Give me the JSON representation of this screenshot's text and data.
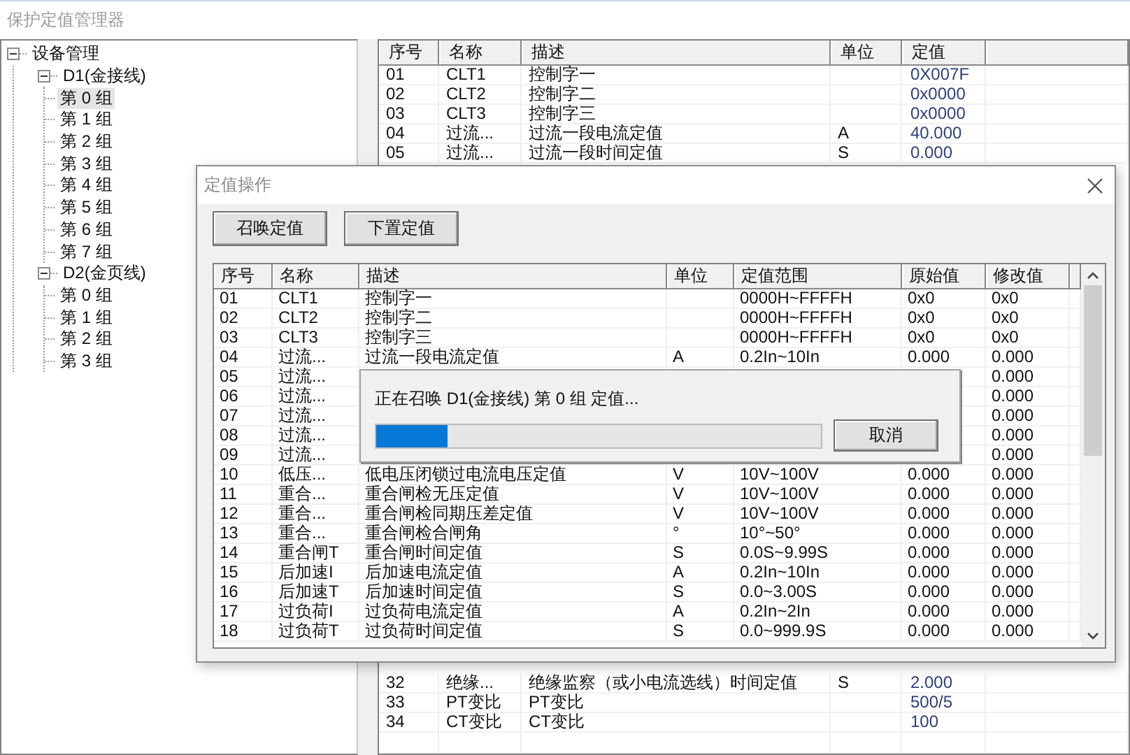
{
  "window": {
    "title": "保护定值管理器"
  },
  "tree": {
    "label": "设备管理",
    "expanded": true,
    "children": [
      {
        "label": "D1(金接线)",
        "expanded": true,
        "children": [
          {
            "label": "第 0 组",
            "selected": true
          },
          {
            "label": "第 1 组",
            "selected": false
          },
          {
            "label": "第 2 组",
            "selected": false
          },
          {
            "label": "第 3 组",
            "selected": false
          },
          {
            "label": "第 4 组",
            "selected": false
          },
          {
            "label": "第 5 组",
            "selected": false
          },
          {
            "label": "第 6 组",
            "selected": false
          },
          {
            "label": "第 7 组",
            "selected": false
          }
        ]
      },
      {
        "label": "D2(金页线)",
        "expanded": true,
        "children": [
          {
            "label": "第 0 组",
            "selected": false
          },
          {
            "label": "第 1 组",
            "selected": false
          },
          {
            "label": "第 2 组",
            "selected": false
          },
          {
            "label": "第 3 组",
            "selected": false
          }
        ]
      }
    ]
  },
  "table": {
    "columns": [
      "序号",
      "名称",
      "描述",
      "单位",
      "定值"
    ],
    "upper_rows": [
      {
        "no": "01",
        "name": "CLT1",
        "desc": "控制字一",
        "value": "0X007F"
      },
      {
        "no": "02",
        "name": "CLT2",
        "desc": "控制字二",
        "value": "0x0000"
      },
      {
        "no": "03",
        "name": "CLT3",
        "desc": "控制字三",
        "value": "0x0000"
      },
      {
        "no": "04",
        "name": "过流...",
        "desc": "过流一段电流定值",
        "unit": "A",
        "value": "40.000"
      },
      {
        "no": "05",
        "name": "过流...",
        "desc": "过流一段时间定值",
        "unit": "S",
        "value": "0.000"
      }
    ],
    "lower_rows": [
      {
        "no": "32",
        "name": "绝缘...",
        "desc": "绝缘监察（或小电流选线）时间定值",
        "unit": "S",
        "value": "2.000"
      },
      {
        "no": "33",
        "name": "PT变比",
        "desc": "PT变比",
        "value": "500/5"
      },
      {
        "no": "34",
        "name": "CT变比",
        "desc": "CT变比",
        "value": "100"
      }
    ]
  },
  "dialog": {
    "title": "定值操作",
    "buttons": [
      "召唤定值",
      "下置定值"
    ],
    "columns": [
      "序号",
      "名称",
      "描述",
      "单位",
      "定值范围",
      "原始值",
      "修改值"
    ],
    "rows": [
      {
        "no": "01",
        "name": "CLT1",
        "desc": "控制字一",
        "range": "0000H~FFFFH",
        "original": "0x0",
        "modified": "0x0"
      },
      {
        "no": "02",
        "name": "CLT2",
        "desc": "控制字二",
        "range": "0000H~FFFFH",
        "original": "0x0",
        "modified": "0x0"
      },
      {
        "no": "03",
        "name": "CLT3",
        "desc": "控制字三",
        "range": "0000H~FFFFH",
        "original": "0x0",
        "modified": "0x0"
      },
      {
        "no": "04",
        "name": "过流...",
        "desc": "过流一段电流定值",
        "unit": "A",
        "range": "0.2In~10In",
        "original": "0.000",
        "modified": "0.000"
      },
      {
        "no": "05",
        "name": "过流...",
        "modified": "0.000"
      },
      {
        "no": "06",
        "name": "过流...",
        "modified": "0.000"
      },
      {
        "no": "07",
        "name": "过流...",
        "modified": "0.000"
      },
      {
        "no": "08",
        "name": "过流...",
        "modified": "0.000"
      },
      {
        "no": "09",
        "name": "过流...",
        "modified": "0.000"
      },
      {
        "no": "10",
        "name": "低压...",
        "desc": "低电压闭锁过电流电压定值",
        "unit": "V",
        "range": "10V~100V",
        "original": "0.000",
        "modified": "0.000"
      },
      {
        "no": "11",
        "name": "重合...",
        "desc": "重合闸检无压定值",
        "unit": "V",
        "range": "10V~100V",
        "original": "0.000",
        "modified": "0.000"
      },
      {
        "no": "12",
        "name": "重合...",
        "desc": "重合闸检同期压差定值",
        "unit": "V",
        "range": "10V~100V",
        "original": "0.000",
        "modified": "0.000"
      },
      {
        "no": "13",
        "name": "重合...",
        "desc": "重合闸检合闸角",
        "unit": "°",
        "range": "10°~50°",
        "original": "0.000",
        "modified": "0.000"
      },
      {
        "no": "14",
        "name": "重合闸T",
        "desc": "重合闸时间定值",
        "unit": "S",
        "range": "0.0S~9.99S",
        "original": "0.000",
        "modified": "0.000"
      },
      {
        "no": "15",
        "name": "后加速I",
        "desc": "后加速电流定值",
        "unit": "A",
        "range": "0.2In~10In",
        "original": "0.000",
        "modified": "0.000"
      },
      {
        "no": "16",
        "name": "后加速T",
        "desc": "后加速时间定值",
        "unit": "S",
        "range": "0.0~3.00S",
        "original": "0.000",
        "modified": "0.000"
      },
      {
        "no": "17",
        "name": "过负荷I",
        "desc": "过负荷电流定值",
        "unit": "A",
        "range": "0.2In~2In",
        "original": "0.000",
        "modified": "0.000"
      },
      {
        "no": "18",
        "name": "过负荷T",
        "desc": "过负荷时间定值",
        "unit": "S",
        "range": "0.0~999.9S",
        "original": "0.000",
        "modified": "0.000"
      }
    ]
  },
  "progress": {
    "message": "正在召唤 D1(金接线) 第 0 组 定值...",
    "level": 0.16,
    "button": "取消"
  }
}
